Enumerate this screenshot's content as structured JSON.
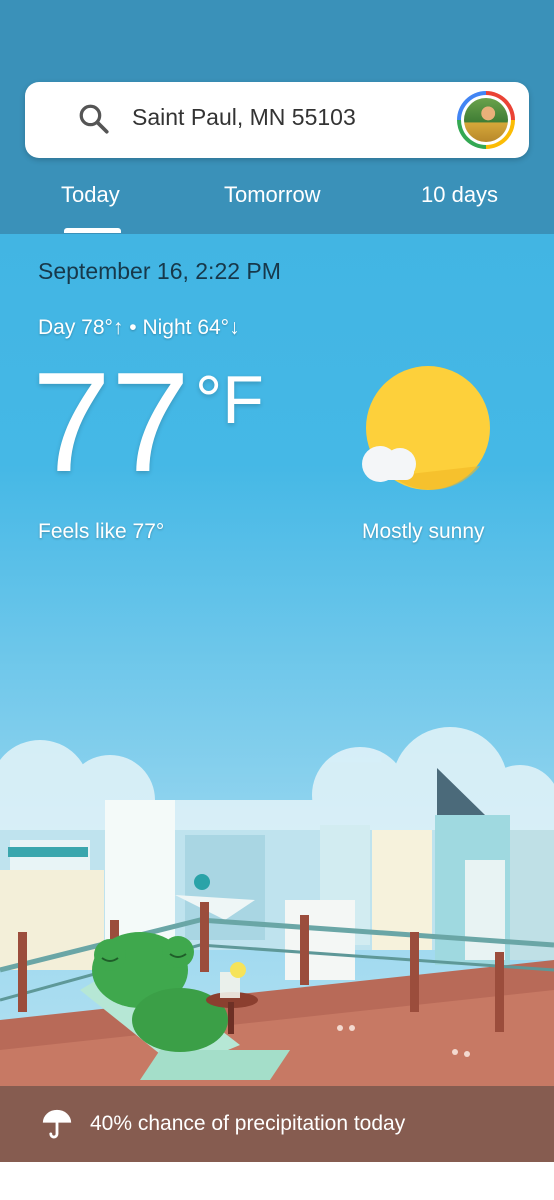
{
  "search": {
    "location": "Saint Paul, MN 55103",
    "icon": "search-icon"
  },
  "tabs": [
    {
      "label": "Today"
    },
    {
      "label": "Tomorrow"
    },
    {
      "label": "10 days"
    }
  ],
  "current": {
    "datetime": "September 16, 2:22 PM",
    "day_night": "Day 78°↑ • Night 64°↓",
    "temperature": "77",
    "unit": "°F",
    "feels_like": "Feels like 77°",
    "condition": "Mostly sunny",
    "condition_icon": "partly-sunny-icon"
  },
  "precipitation": {
    "text": "40% chance of precipitation today",
    "icon": "umbrella-icon"
  },
  "colors": {
    "header": "#3a91b9",
    "sky": "#45b8e6",
    "sun": "#fdd03b",
    "roof": "#b96a5a"
  }
}
